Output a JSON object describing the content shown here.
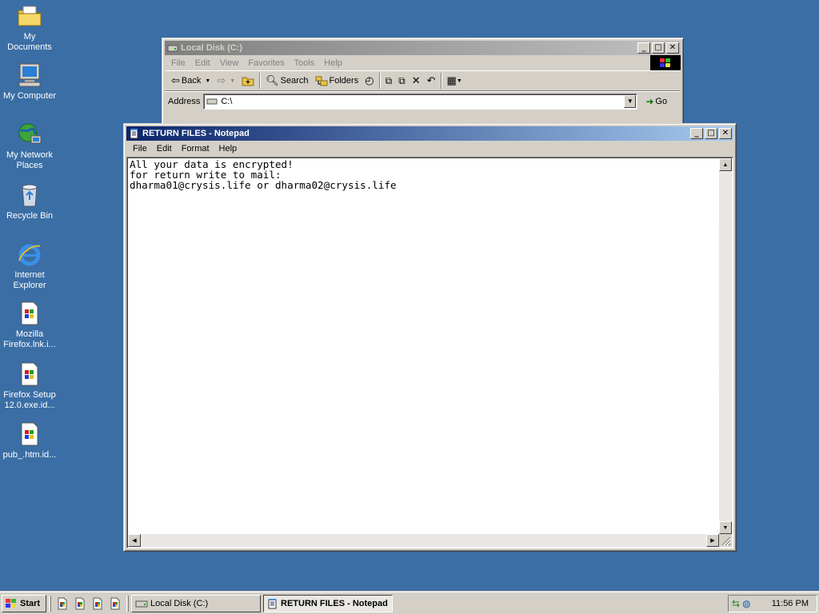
{
  "colors": {
    "desktop": "#3a6ea5",
    "title_active": "#0a246a",
    "title_inactive": "#808080",
    "face": "#d4d0c8"
  },
  "desktop": {
    "icons": [
      {
        "label": "My Documents",
        "icon": "folder-documents-icon"
      },
      {
        "label": "My Computer",
        "icon": "computer-icon"
      },
      {
        "label": "My Network Places",
        "icon": "network-icon"
      },
      {
        "label": "Recycle Bin",
        "icon": "recycle-bin-icon"
      },
      {
        "label": "Internet Explorer",
        "icon": "ie-icon"
      },
      {
        "label": "Mozilla Firefox.lnk.i...",
        "icon": "file-icon"
      },
      {
        "label": "Firefox Setup 12.0.exe.id...",
        "icon": "file-icon"
      },
      {
        "label": "pub_.htm.id...",
        "icon": "file-icon"
      }
    ]
  },
  "explorer": {
    "title": "Local Disk (C:)",
    "menu": [
      "File",
      "Edit",
      "View",
      "Favorites",
      "Tools",
      "Help"
    ],
    "toolbar": {
      "back": "Back",
      "search": "Search",
      "folders": "Folders"
    },
    "address": {
      "label": "Address",
      "value": "C:\\",
      "go": "Go"
    }
  },
  "notepad": {
    "title": "RETURN FILES - Notepad",
    "menu": [
      "File",
      "Edit",
      "Format",
      "Help"
    ],
    "content": "All your data is encrypted!\nfor return write to mail:\ndharma01@crysis.life or dharma02@crysis.life"
  },
  "taskbar": {
    "start": "Start",
    "tasks": [
      {
        "label": "Local Disk (C:)",
        "active": false
      },
      {
        "label": "RETURN FILES - Notepad",
        "active": true
      }
    ],
    "clock": "11:56 PM"
  }
}
